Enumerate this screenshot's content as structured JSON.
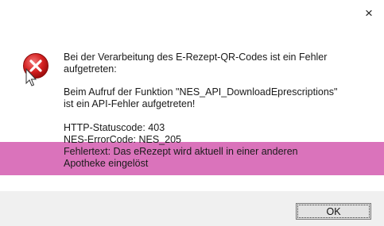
{
  "dialog": {
    "close_label": "×",
    "message": {
      "line1": "Bei der Verarbeitung des E-Rezept-QR-Codes ist ein Fehler",
      "line2": "aufgetreten:",
      "line3": "Beim Aufruf der Funktion \"NES_API_DownloadEprescriptions\"",
      "line4": "ist ein API-Fehler aufgetreten!",
      "line5": "HTTP-Statuscode: 403",
      "line6": "NES-ErrorCode: NES_205",
      "line7": "Fehlertext: Das eRezept wird aktuell in einer anderen",
      "line8": "Apotheke eingelöst"
    },
    "ok_label": "OK",
    "icon": "error-icon",
    "highlight_color": "#d45aaf"
  }
}
